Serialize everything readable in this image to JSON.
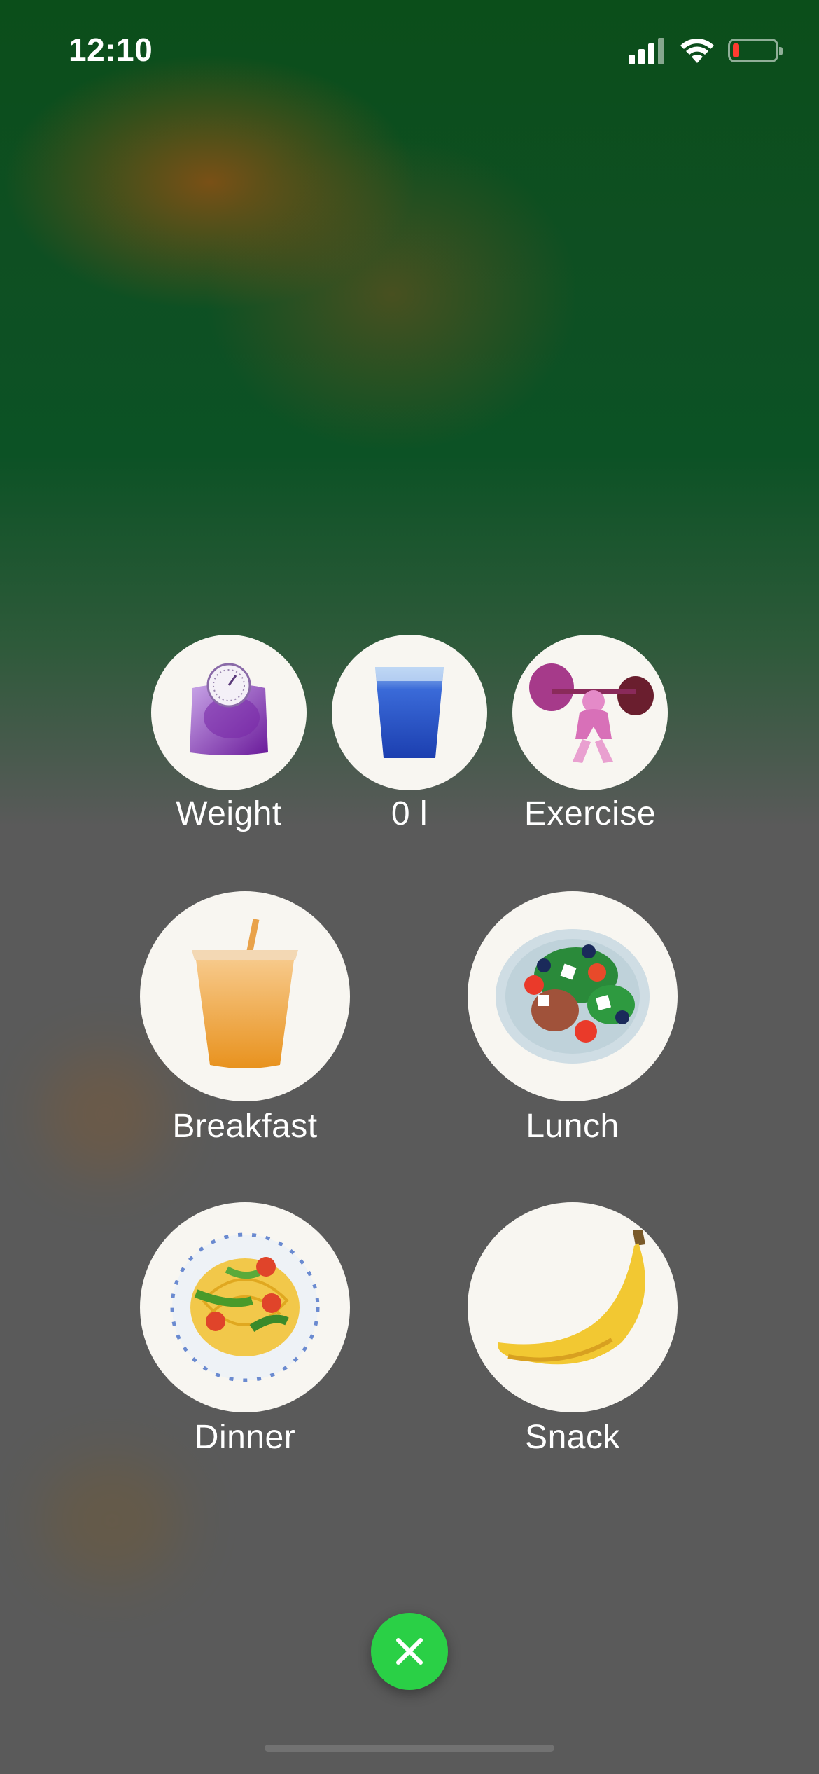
{
  "status_bar": {
    "time": "12:10",
    "icons": [
      "cellular-signal-icon",
      "wifi-icon",
      "battery-low-icon"
    ],
    "battery_color": "#ff3b30"
  },
  "quick_actions": [
    {
      "id": "weight",
      "label": "Weight",
      "icon": "weighing-scale-icon"
    },
    {
      "id": "water",
      "label": "0 l",
      "icon": "water-glass-icon"
    },
    {
      "id": "exercise",
      "label": "Exercise",
      "icon": "weightlifter-icon"
    }
  ],
  "meals": [
    {
      "id": "breakfast",
      "label": "Breakfast",
      "icon": "juice-cup-icon"
    },
    {
      "id": "lunch",
      "label": "Lunch",
      "icon": "salad-bowl-icon"
    },
    {
      "id": "dinner",
      "label": "Dinner",
      "icon": "pasta-plate-icon"
    },
    {
      "id": "snack",
      "label": "Snack",
      "icon": "banana-icon"
    }
  ],
  "close_button": {
    "icon": "close-icon",
    "color": "#2ad046"
  }
}
